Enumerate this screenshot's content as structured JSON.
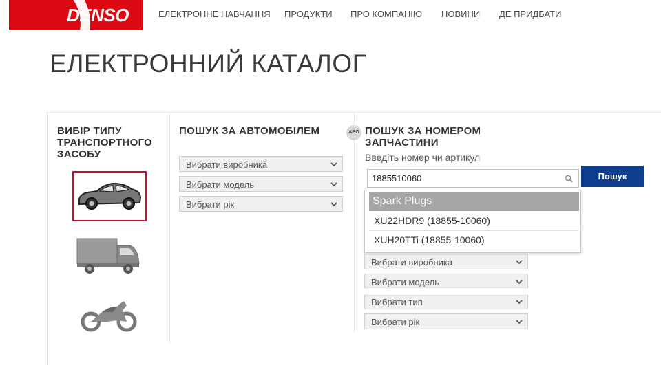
{
  "header": {
    "logo_text": "DENSO",
    "nav": [
      "ЕЛЕКТРОННЕ НАВЧАННЯ",
      "ПРОДУКТИ",
      "ПРО КОМПАНІЮ",
      "НОВИНИ",
      "ДЕ ПРИДБАТИ"
    ]
  },
  "page_title": "ЕЛЕКТРОННИЙ КАТАЛОГ",
  "vehicle_type": {
    "heading_lines": [
      "ВИБІР ТИПУ",
      "ТРАНСПОРТНОГО",
      "ЗАСОБУ"
    ],
    "options": [
      "car-icon",
      "truck-icon",
      "motorcycle-icon"
    ],
    "selected": "car-icon"
  },
  "car_search": {
    "heading": "ПОШУК ЗА АВТОМОБІЛЕМ",
    "selects": [
      "Вибрати виробника",
      "Вибрати модель",
      "Вибрати рік"
    ]
  },
  "or_badge": "АБО",
  "part_search": {
    "heading_lines": [
      "ПОШУК ЗА НОМЕРОМ",
      "ЗАПЧАСТИНИ"
    ],
    "hint": "Введіть номер чи артикул",
    "input_value": "1885510060",
    "button_label": "Пошук",
    "dropdown": {
      "group": "Spark Plugs",
      "items": [
        "XU22HDR9 (18855-10060)",
        "XUH20TTi (18855-10060)"
      ]
    },
    "lower_selects": [
      "Вибрати виробника",
      "Вибрати модель",
      "Вибрати тип",
      "Вибрати рік"
    ]
  },
  "colors": {
    "brand_red": "#dc0a12",
    "button_blue": "#0d3d8c",
    "selected_border": "#c8102e"
  }
}
